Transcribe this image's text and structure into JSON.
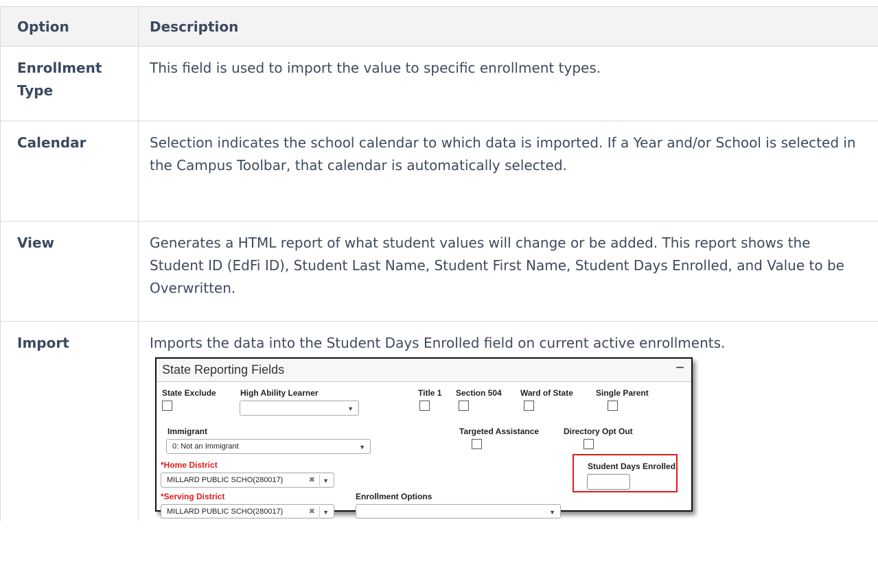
{
  "table": {
    "headers": {
      "option": "Option",
      "description": "Description"
    },
    "rows": [
      {
        "option": "Enrollment Type",
        "description": "This field is used to import the value to specific enrollment types."
      },
      {
        "option": "Calendar",
        "description": "Selection indicates the school calendar to which data is imported. If a Year and/or School is selected in the Campus Toolbar, that calendar is automatically selected."
      },
      {
        "option": "View",
        "description": "Generates a HTML report of what student values will change or be added. This report shows the Student ID (EdFi ID), Student Last Name, Student First Name, Student Days Enrolled, and Value to be Overwritten."
      },
      {
        "option": "Import",
        "description": "Imports the data into the Student Days Enrolled field on current active enrollments."
      }
    ]
  },
  "screenshot": {
    "title": "State Reporting Fields",
    "collapse_symbol": "−",
    "labels": {
      "state_exclude": "State Exclude",
      "high_ability_learner": "High Ability Learner",
      "title_1": "Title 1",
      "section_504": "Section 504",
      "ward_of_state": "Ward of State",
      "single_parent": "Single Parent",
      "immigrant": "Immigrant",
      "targeted_assistance": "Targeted Assistance",
      "directory_opt_out": "Directory Opt Out",
      "home_district": "*Home District",
      "student_days_enrolled": "Student Days Enrolled",
      "serving_district": "*Serving District",
      "enrollment_options": "Enrollment Options"
    },
    "values": {
      "high_ability_learner": "",
      "immigrant": "0: Not an Immigrant",
      "home_district": "MILLARD PUBLIC SCHO(280017)",
      "serving_district": "MILLARD PUBLIC SCHO(280017)",
      "enrollment_options": "",
      "student_days_enrolled": ""
    },
    "icons": {
      "dropdown": "▼",
      "clear": "✖"
    },
    "colors": {
      "required_label": "#e0191d",
      "highlight_box": "#e0191d"
    }
  }
}
